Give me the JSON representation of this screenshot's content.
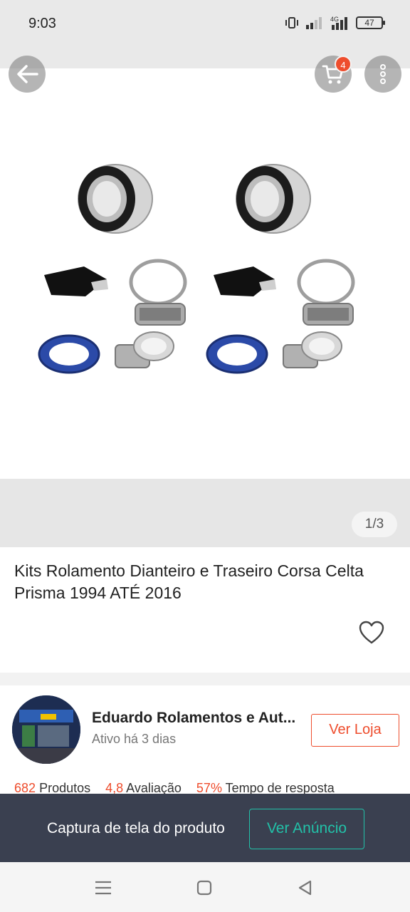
{
  "status_bar": {
    "time": "9:03",
    "battery": "47",
    "network": "4G"
  },
  "top_actions": {
    "cart_badge": "4"
  },
  "gallery": {
    "pager": "1/3"
  },
  "product": {
    "title": "Kits Rolamento Dianteiro e Traseiro Corsa Celta Prisma 1994 ATÉ 2016"
  },
  "seller": {
    "name": "Eduardo Rolamentos e Aut...",
    "status": "Ativo há 3 dias",
    "shop_button": "Ver Loja",
    "stats": [
      {
        "value": "682",
        "label": "Produtos"
      },
      {
        "value": "4,8",
        "label": "Avaliação"
      },
      {
        "value": "57%",
        "label": "Tempo de resposta"
      }
    ]
  },
  "capture_bar": {
    "text": "Captura de tela do produto",
    "button": "Ver Anúncio"
  },
  "colors": {
    "accent": "#ee4d2d",
    "teal": "#22c1a8",
    "overlay": "#3a4050"
  }
}
